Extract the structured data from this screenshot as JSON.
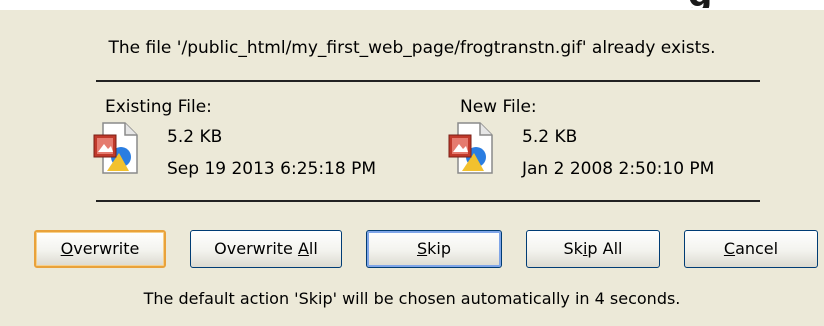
{
  "message": "The file '/public_html/my_first_web_page/frogtranstn.gif' already exists.",
  "existing_file": {
    "heading": "Existing File:",
    "size": "5.2 KB",
    "date": "Sep 19 2013 6:25:18 PM",
    "icon": "image-file-icon"
  },
  "new_file": {
    "heading": "New File:",
    "size": "5.2 KB",
    "date": "Jan 2 2008 2:50:10 PM",
    "icon": "image-file-icon"
  },
  "buttons": {
    "overwrite": {
      "before": "",
      "mnemonic": "O",
      "after": "verwrite"
    },
    "overwrite_all": {
      "before": "Overwrite ",
      "mnemonic": "A",
      "after": "ll"
    },
    "skip": {
      "before": "",
      "mnemonic": "S",
      "after": "kip"
    },
    "skip_all": {
      "before": "Sk",
      "mnemonic": "i",
      "after": "p All"
    },
    "cancel": {
      "before": "",
      "mnemonic": "C",
      "after": "ancel"
    }
  },
  "footer": "The default action 'Skip' will be chosen automatically in 4 seconds.",
  "colors": {
    "dialog_bg": "#ece9d8",
    "button_border": "#003c74",
    "default_button_highlight": "#e9a23b",
    "focus_highlight": "#7fa5e8"
  }
}
